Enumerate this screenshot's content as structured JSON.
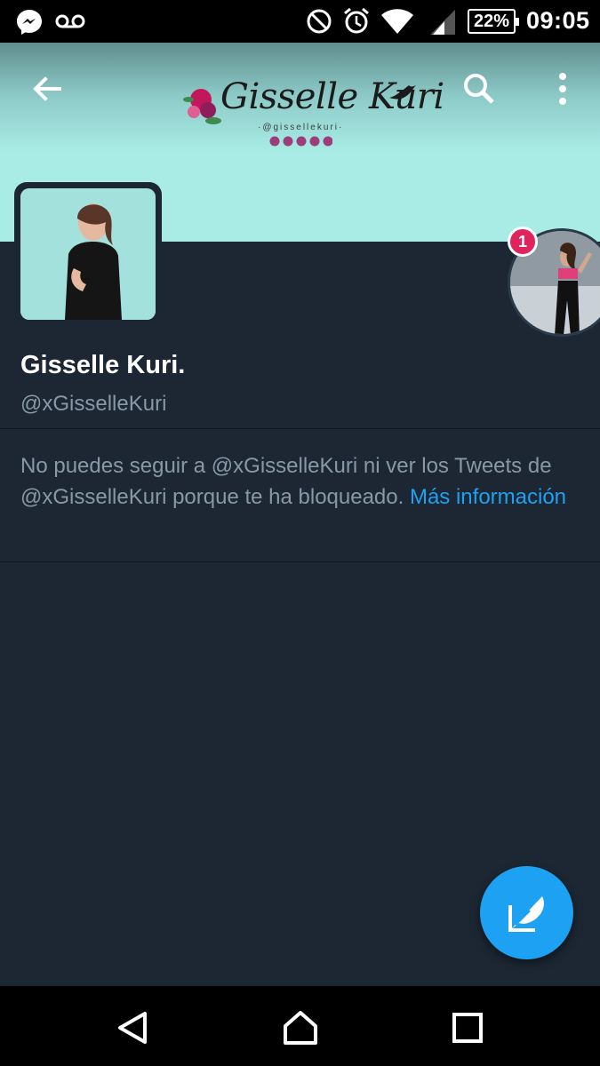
{
  "status_bar": {
    "battery": "22%",
    "time": "09:05",
    "icons": [
      "messenger-icon",
      "voicemail-icon",
      "do-not-disturb-icon",
      "alarm-icon",
      "wifi-icon",
      "cell-signal-icon",
      "battery-icon"
    ]
  },
  "header": {
    "banner_title": "Gisselle Kuri",
    "banner_handle": "·@gissellekuri·",
    "icons": [
      "back-arrow-icon",
      "search-icon",
      "overflow-menu-icon"
    ]
  },
  "story": {
    "badge_count": "1"
  },
  "profile": {
    "name": "Gisselle Kuri.",
    "handle": "@xGisselleKuri"
  },
  "blocked": {
    "message": "No puedes seguir a @xGisselleKuri ni ver los Tweets de @xGisselleKuri porque te ha bloqueado. ",
    "link": "Más información"
  },
  "fab": {
    "icon": "compose-tweet-icon"
  },
  "nav_bar": {
    "icons": [
      "back-triangle-icon",
      "home-icon",
      "recents-icon"
    ]
  },
  "colors": {
    "background": "#1c2733",
    "banner": "#a9ece6",
    "accent": "#1da1f2",
    "muted_text": "#8899a6",
    "badge": "#e0245e"
  }
}
